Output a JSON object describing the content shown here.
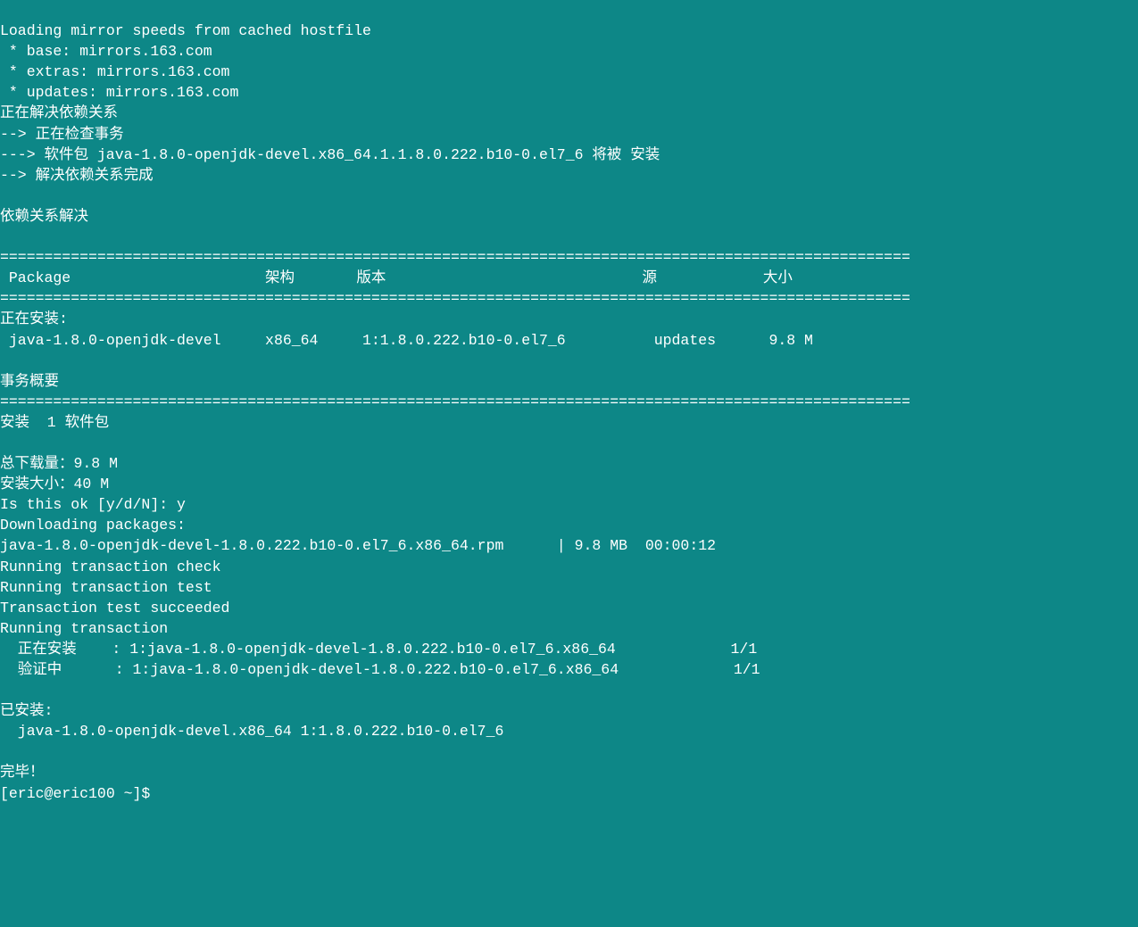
{
  "lines": [
    "Loading mirror speeds from cached hostfile",
    " * base: mirrors.163.com",
    " * extras: mirrors.163.com",
    " * updates: mirrors.163.com",
    "正在解决依赖关系",
    "--> 正在检查事务",
    "---> 软件包 java-1.8.0-openjdk-devel.x86_64.1.1.8.0.222.b10-0.el7_6 将被 安装",
    "--> 解决依赖关系完成",
    "",
    "依赖关系解决",
    "",
    "=======================================================================================================",
    " Package                      架构       版本                             源            大小",
    "=======================================================================================================",
    "正在安装:",
    " java-1.8.0-openjdk-devel     x86_64     1:1.8.0.222.b10-0.el7_6          updates      9.8 M",
    "",
    "事务概要",
    "=======================================================================================================",
    "安装  1 软件包",
    "",
    "总下载量：9.8 M",
    "安装大小：40 M",
    "Is this ok [y/d/N]: y",
    "Downloading packages:",
    "java-1.8.0-openjdk-devel-1.8.0.222.b10-0.el7_6.x86_64.rpm      | 9.8 MB  00:00:12",
    "Running transaction check",
    "Running transaction test",
    "Transaction test succeeded",
    "Running transaction",
    "  正在安装    : 1:java-1.8.0-openjdk-devel-1.8.0.222.b10-0.el7_6.x86_64             1/1",
    "  验证中      : 1:java-1.8.0-openjdk-devel-1.8.0.222.b10-0.el7_6.x86_64             1/1",
    "",
    "已安装:",
    "  java-1.8.0-openjdk-devel.x86_64 1:1.8.0.222.b10-0.el7_6",
    "",
    "完毕！",
    "[eric@eric100 ~]$ "
  ]
}
